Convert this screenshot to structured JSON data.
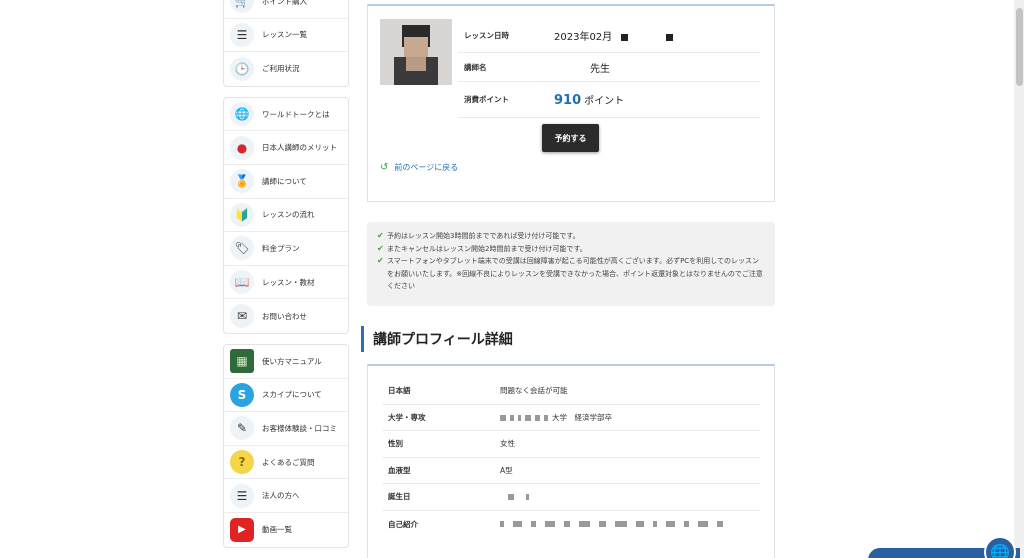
{
  "sidebar": {
    "group1": [
      {
        "label": "ポイント購入",
        "icon": "cart-icon",
        "glyph": "🛒"
      },
      {
        "label": "レッスン一覧",
        "icon": "list-icon",
        "glyph": "☰"
      },
      {
        "label": "ご利用状況",
        "icon": "clock-icon",
        "glyph": "🕒"
      }
    ],
    "group2": [
      {
        "label": "ワールドトークとは",
        "icon": "globe-icon",
        "glyph": "🌐"
      },
      {
        "label": "日本人講師のメリット",
        "icon": "japan-flag-icon",
        "glyph": "●"
      },
      {
        "label": "講師について",
        "icon": "award-badge-icon",
        "glyph": "🏅"
      },
      {
        "label": "レッスンの流れ",
        "icon": "beginner-mark-icon",
        "glyph": "🔰"
      },
      {
        "label": "料金プラン",
        "icon": "price-tag-icon",
        "glyph": "🏷"
      },
      {
        "label": "レッスン・教材",
        "icon": "book-icon",
        "glyph": "📖"
      },
      {
        "label": "お問い合わせ",
        "icon": "mail-icon",
        "glyph": "✉"
      }
    ],
    "group3": [
      {
        "label": "使い方マニュアル",
        "icon": "blackboard-icon",
        "glyph": "▦"
      },
      {
        "label": "スカイプについて",
        "icon": "skype-icon",
        "glyph": "S"
      },
      {
        "label": "お客様体験談・口コミ",
        "icon": "pencils-icon",
        "glyph": "✎"
      },
      {
        "label": "よくあるご質問",
        "icon": "question-icon",
        "glyph": "?"
      },
      {
        "label": "法人の方へ",
        "icon": "document-icon",
        "glyph": "☰"
      },
      {
        "label": "動画一覧",
        "icon": "youtube-icon",
        "glyph": "▶"
      }
    ]
  },
  "lesson": {
    "datetime_label": "レッスン日時",
    "datetime_value": "2023年02月",
    "teacher_label": "講師名",
    "teacher_suffix": "先生",
    "points_label": "消費ポイント",
    "points_value": "910",
    "points_unit": "ポイント",
    "reserve_button": "予約する",
    "back_link": "前のページに戻る"
  },
  "notice": {
    "items": [
      "予約はレッスン開始3時間前までであれば受け付け可能です。",
      "またキャンセルはレッスン開始2時間前まで受け付け可能です。",
      "スマートフォンやタブレット端末での受講は回線障害が起こる可能性が高くございます。必ずPCを利用してのレッスンをお願いいたします。※回線不良によりレッスンを受講できなかった場合、ポイント返還対象とはなりませんのでご注意ください"
    ]
  },
  "profile": {
    "heading": "講師プロフィール詳細",
    "rows": [
      {
        "label": "日本語",
        "value": "問題なく会話が可能"
      },
      {
        "label": "大学・専攻",
        "value": "大学　経済学部卒"
      },
      {
        "label": "性別",
        "value": "女性"
      },
      {
        "label": "血液型",
        "value": "A型"
      },
      {
        "label": "誕生日",
        "value": ""
      },
      {
        "label": "自己紹介",
        "value": ""
      }
    ]
  },
  "colors": {
    "accent": "#2f6db5",
    "points": "#1f6fb5",
    "check": "#3aa53a",
    "button_bg": "#2b2b2b",
    "chat_bg": "#2a5fa4"
  }
}
